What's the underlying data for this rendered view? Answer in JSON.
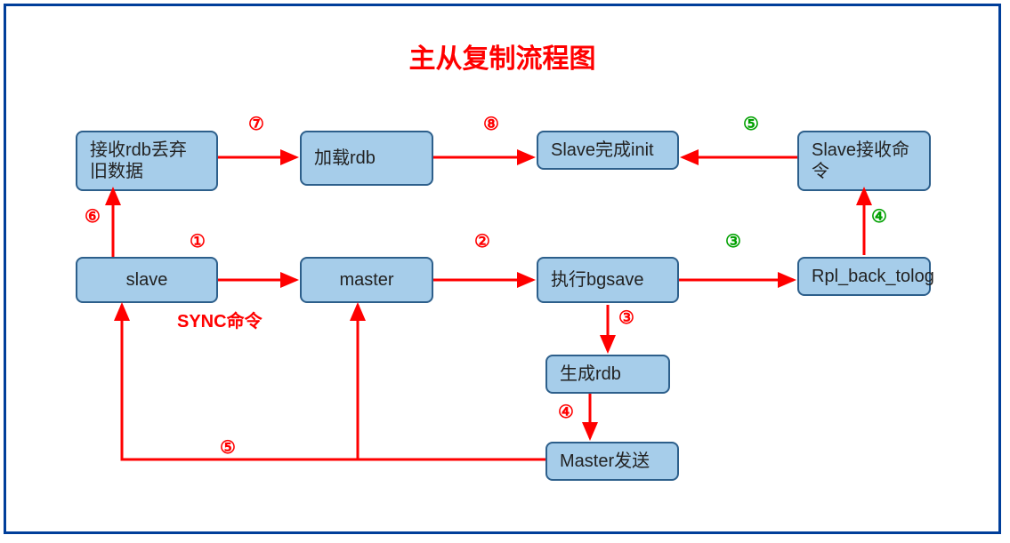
{
  "title": "主从复制流程图",
  "nodes": {
    "recv_rdb": "接收rdb丢弃旧数据",
    "load_rdb": "加载rdb",
    "slave_init": "Slave完成init",
    "slave_recv_cmd": "Slave接收命令",
    "slave": "slave",
    "master": "master",
    "bgsave": "执行bgsave",
    "rpl_back": "Rpl_back_tolog",
    "gen_rdb": "生成rdb",
    "master_send": "Master发送"
  },
  "labels": {
    "e1": "①",
    "e2": "②",
    "e3a": "③",
    "e3b": "③",
    "e4a": "④",
    "e4b": "④",
    "e5a": "⑤",
    "e5b": "⑤",
    "e6": "⑥",
    "e7": "⑦",
    "e8": "⑧",
    "sync": "SYNC命令"
  }
}
